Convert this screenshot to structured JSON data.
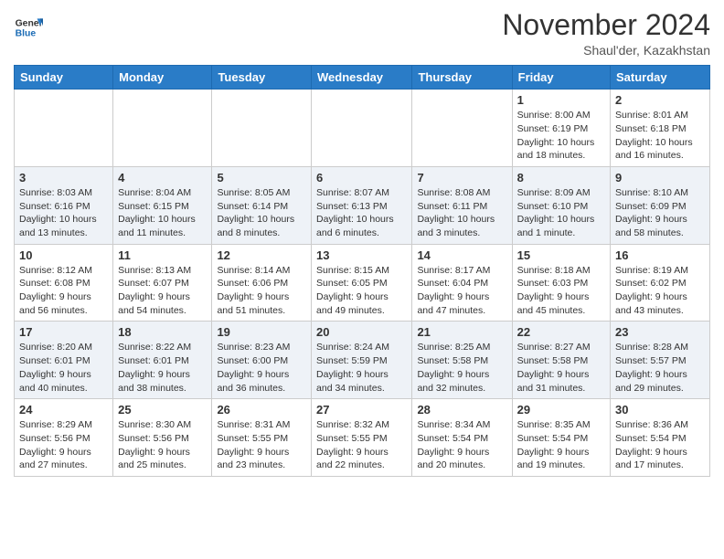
{
  "header": {
    "logo_general": "General",
    "logo_blue": "Blue",
    "month_title": "November 2024",
    "location": "Shaul'der, Kazakhstan"
  },
  "calendar": {
    "days_of_week": [
      "Sunday",
      "Monday",
      "Tuesday",
      "Wednesday",
      "Thursday",
      "Friday",
      "Saturday"
    ],
    "weeks": [
      [
        {
          "day": "",
          "info": ""
        },
        {
          "day": "",
          "info": ""
        },
        {
          "day": "",
          "info": ""
        },
        {
          "day": "",
          "info": ""
        },
        {
          "day": "",
          "info": ""
        },
        {
          "day": "1",
          "info": "Sunrise: 8:00 AM\nSunset: 6:19 PM\nDaylight: 10 hours\nand 18 minutes."
        },
        {
          "day": "2",
          "info": "Sunrise: 8:01 AM\nSunset: 6:18 PM\nDaylight: 10 hours\nand 16 minutes."
        }
      ],
      [
        {
          "day": "3",
          "info": "Sunrise: 8:03 AM\nSunset: 6:16 PM\nDaylight: 10 hours\nand 13 minutes."
        },
        {
          "day": "4",
          "info": "Sunrise: 8:04 AM\nSunset: 6:15 PM\nDaylight: 10 hours\nand 11 minutes."
        },
        {
          "day": "5",
          "info": "Sunrise: 8:05 AM\nSunset: 6:14 PM\nDaylight: 10 hours\nand 8 minutes."
        },
        {
          "day": "6",
          "info": "Sunrise: 8:07 AM\nSunset: 6:13 PM\nDaylight: 10 hours\nand 6 minutes."
        },
        {
          "day": "7",
          "info": "Sunrise: 8:08 AM\nSunset: 6:11 PM\nDaylight: 10 hours\nand 3 minutes."
        },
        {
          "day": "8",
          "info": "Sunrise: 8:09 AM\nSunset: 6:10 PM\nDaylight: 10 hours\nand 1 minute."
        },
        {
          "day": "9",
          "info": "Sunrise: 8:10 AM\nSunset: 6:09 PM\nDaylight: 9 hours\nand 58 minutes."
        }
      ],
      [
        {
          "day": "10",
          "info": "Sunrise: 8:12 AM\nSunset: 6:08 PM\nDaylight: 9 hours\nand 56 minutes."
        },
        {
          "day": "11",
          "info": "Sunrise: 8:13 AM\nSunset: 6:07 PM\nDaylight: 9 hours\nand 54 minutes."
        },
        {
          "day": "12",
          "info": "Sunrise: 8:14 AM\nSunset: 6:06 PM\nDaylight: 9 hours\nand 51 minutes."
        },
        {
          "day": "13",
          "info": "Sunrise: 8:15 AM\nSunset: 6:05 PM\nDaylight: 9 hours\nand 49 minutes."
        },
        {
          "day": "14",
          "info": "Sunrise: 8:17 AM\nSunset: 6:04 PM\nDaylight: 9 hours\nand 47 minutes."
        },
        {
          "day": "15",
          "info": "Sunrise: 8:18 AM\nSunset: 6:03 PM\nDaylight: 9 hours\nand 45 minutes."
        },
        {
          "day": "16",
          "info": "Sunrise: 8:19 AM\nSunset: 6:02 PM\nDaylight: 9 hours\nand 43 minutes."
        }
      ],
      [
        {
          "day": "17",
          "info": "Sunrise: 8:20 AM\nSunset: 6:01 PM\nDaylight: 9 hours\nand 40 minutes."
        },
        {
          "day": "18",
          "info": "Sunrise: 8:22 AM\nSunset: 6:01 PM\nDaylight: 9 hours\nand 38 minutes."
        },
        {
          "day": "19",
          "info": "Sunrise: 8:23 AM\nSunset: 6:00 PM\nDaylight: 9 hours\nand 36 minutes."
        },
        {
          "day": "20",
          "info": "Sunrise: 8:24 AM\nSunset: 5:59 PM\nDaylight: 9 hours\nand 34 minutes."
        },
        {
          "day": "21",
          "info": "Sunrise: 8:25 AM\nSunset: 5:58 PM\nDaylight: 9 hours\nand 32 minutes."
        },
        {
          "day": "22",
          "info": "Sunrise: 8:27 AM\nSunset: 5:58 PM\nDaylight: 9 hours\nand 31 minutes."
        },
        {
          "day": "23",
          "info": "Sunrise: 8:28 AM\nSunset: 5:57 PM\nDaylight: 9 hours\nand 29 minutes."
        }
      ],
      [
        {
          "day": "24",
          "info": "Sunrise: 8:29 AM\nSunset: 5:56 PM\nDaylight: 9 hours\nand 27 minutes."
        },
        {
          "day": "25",
          "info": "Sunrise: 8:30 AM\nSunset: 5:56 PM\nDaylight: 9 hours\nand 25 minutes."
        },
        {
          "day": "26",
          "info": "Sunrise: 8:31 AM\nSunset: 5:55 PM\nDaylight: 9 hours\nand 23 minutes."
        },
        {
          "day": "27",
          "info": "Sunrise: 8:32 AM\nSunset: 5:55 PM\nDaylight: 9 hours\nand 22 minutes."
        },
        {
          "day": "28",
          "info": "Sunrise: 8:34 AM\nSunset: 5:54 PM\nDaylight: 9 hours\nand 20 minutes."
        },
        {
          "day": "29",
          "info": "Sunrise: 8:35 AM\nSunset: 5:54 PM\nDaylight: 9 hours\nand 19 minutes."
        },
        {
          "day": "30",
          "info": "Sunrise: 8:36 AM\nSunset: 5:54 PM\nDaylight: 9 hours\nand 17 minutes."
        }
      ]
    ]
  }
}
